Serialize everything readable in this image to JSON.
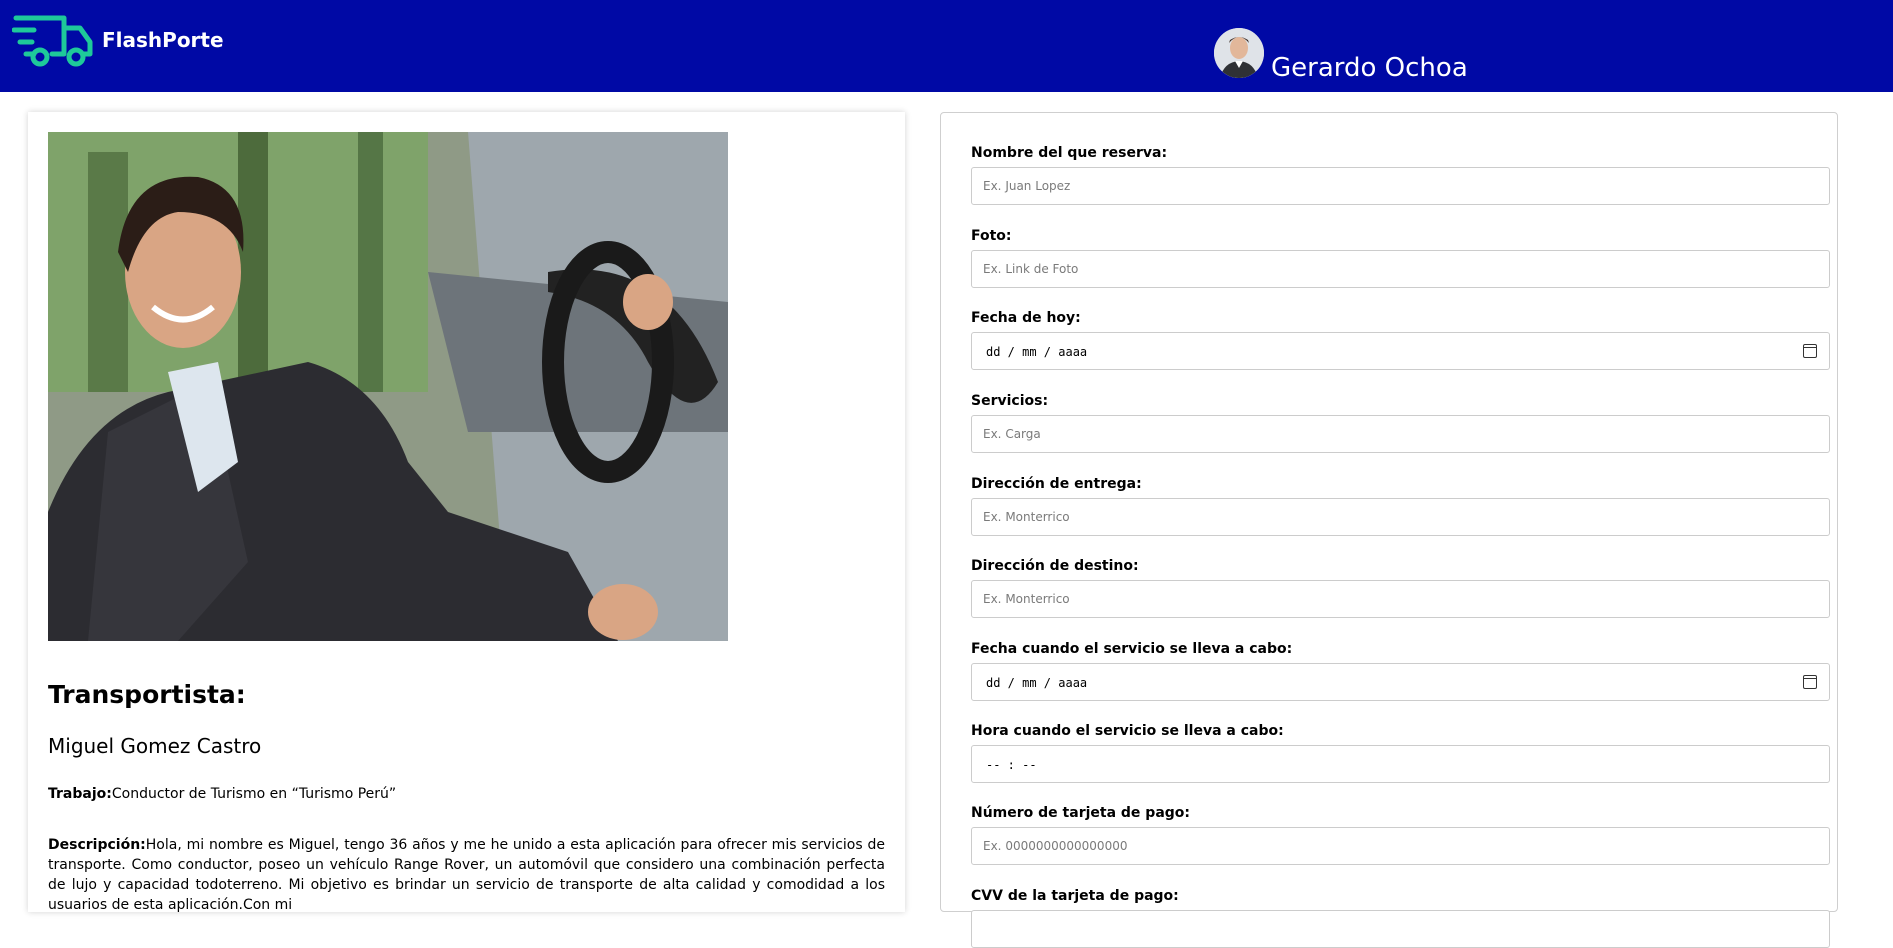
{
  "header": {
    "brand": "FlashPorte",
    "user_name": "Gerardo Ochoa"
  },
  "profile": {
    "section_title": "Transportista:",
    "name": "Miguel Gomez Castro",
    "job_label": "Trabajo:",
    "job_value": "Conductor de Turismo en “Turismo Perú”",
    "desc_label": "Descripción:",
    "desc_value": "Hola, mi nombre es Miguel, tengo 36 años y me he unido a esta aplicación para ofrecer mis servicios de transporte. Como conductor, poseo un vehículo Range Rover, un automóvil que considero una combinación perfecta de lujo y capacidad todoterreno. Mi objetivo es brindar un servicio de transporte de alta calidad y comodidad a los usuarios de esta aplicación.Con mi"
  },
  "form": {
    "fields": [
      {
        "label": "Nombre del que reserva:",
        "placeholder": "Ex. Juan Lopez"
      },
      {
        "label": "Foto:",
        "placeholder": "Ex. Link de Foto"
      },
      {
        "label": "Fecha de hoy:",
        "placeholder": "dd / mm / aaaa"
      },
      {
        "label": "Servicios:",
        "placeholder": "Ex. Carga"
      },
      {
        "label": "Dirección de entrega:",
        "placeholder": "Ex. Monterrico"
      },
      {
        "label": "Dirección de destino:",
        "placeholder": "Ex. Monterrico"
      },
      {
        "label": "Fecha cuando el servicio se lleva a cabo:",
        "placeholder": "dd / mm / aaaa"
      },
      {
        "label": "Hora cuando el servicio se lleva a cabo:",
        "placeholder": "-- : --"
      },
      {
        "label": "Número de tarjeta de pago:",
        "placeholder": "Ex. 0000000000000000"
      },
      {
        "label": "CVV de la tarjeta de pago:",
        "placeholder": ""
      }
    ]
  },
  "colors": {
    "header_bg": "#0009a5",
    "logo": "#1ec99a"
  },
  "icons": [
    "truck-logo-icon",
    "calendar-icon"
  ]
}
